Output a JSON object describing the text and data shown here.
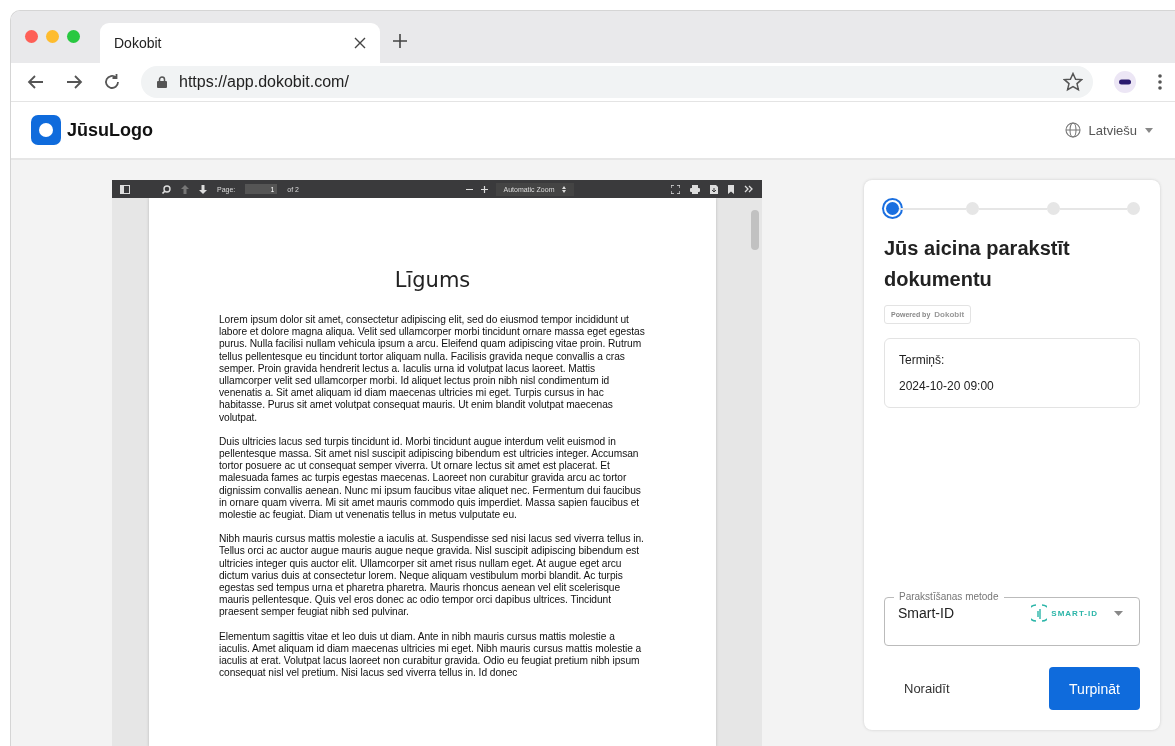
{
  "browser": {
    "tab": {
      "title": "Dokobit"
    },
    "url": "https://app.dokobit.com/"
  },
  "header": {
    "logo": "JūsuLogo",
    "language": "Latviešu"
  },
  "pdf_viewer": {
    "toolbar": {
      "page_label": "Page:",
      "page": "1",
      "page_total": "of 2",
      "zoom": "Automatic Zoom"
    },
    "document": {
      "title": "Līgums",
      "paragraphs": [
        "Lorem ipsum dolor sit amet, consectetur adipiscing elit, sed do eiusmod tempor incididunt ut labore et dolore magna aliqua. Velit sed ullamcorper morbi tincidunt ornare massa eget egestas purus. Nulla facilisi nullam vehicula ipsum a arcu. Eleifend quam adipiscing vitae proin. Rutrum tellus pellentesque eu tincidunt tortor aliquam nulla. Facilisis gravida neque convallis a cras semper. Proin gravida hendrerit lectus a. Iaculis urna id volutpat lacus laoreet. Mattis ullamcorper velit sed ullamcorper morbi. Id aliquet lectus proin nibh nisl condimentum id venenatis a. Sit amet aliquam id diam maecenas ultricies mi eget. Turpis cursus in hac habitasse. Purus sit amet volutpat consequat mauris. Ut enim blandit volutpat maecenas volutpat.",
        "Duis ultricies lacus sed turpis tincidunt id. Morbi tincidunt augue interdum velit euismod in pellentesque massa. Sit amet nisl suscipit adipiscing bibendum est ultricies integer. Accumsan tortor posuere ac ut consequat semper viverra. Ut ornare lectus sit amet est placerat. Et malesuada fames ac turpis egestas maecenas. Laoreet non curabitur gravida arcu ac tortor dignissim convallis aenean. Nunc mi ipsum faucibus vitae aliquet nec. Fermentum dui faucibus in ornare quam viverra. Mi sit amet mauris commodo quis imperdiet. Massa sapien faucibus et molestie ac feugiat. Diam ut venenatis tellus in metus vulputate eu.",
        "Nibh mauris cursus mattis molestie a iaculis at. Suspendisse sed nisi lacus sed viverra tellus in. Tellus orci ac auctor augue mauris augue neque gravida. Nisl suscipit adipiscing bibendum est ultricies integer quis auctor elit. Ullamcorper sit amet risus nullam eget. At augue eget arcu dictum varius duis at consectetur lorem. Neque aliquam vestibulum morbi blandit. Ac turpis egestas sed tempus urna et pharetra pharetra. Mauris rhoncus aenean vel elit scelerisque mauris pellentesque. Quis vel eros donec ac odio tempor orci dapibus ultrices. Tincidunt praesent semper feugiat nibh sed pulvinar.",
        "Elementum sagittis vitae et leo duis ut diam. Ante in nibh mauris cursus mattis molestie a iaculis. Amet aliquam id diam maecenas ultricies mi eget. Nibh mauris cursus mattis molestie a iaculis at erat. Volutpat lacus laoreet non curabitur gravida. Odio eu feugiat pretium nibh ipsum consequat nisl vel pretium. Nisi lacus sed viverra tellus in. Id donec"
      ]
    }
  },
  "signing_panel": {
    "steps": [
      {
        "selected": true
      },
      {
        "selected": false
      },
      {
        "selected": false
      },
      {
        "selected": false
      }
    ],
    "title": "Jūs aicina parakstīt dokumentu",
    "powered_by": "Powered by",
    "powered_brand": "Dokobit",
    "deadline": {
      "label": "Termiņš:",
      "value": "2024-10-20 09:00"
    },
    "method": {
      "label": "Parakstīšanas metode",
      "value": "Smart-ID",
      "logo_text": "SMART-ID"
    },
    "buttons": {
      "reject": "Noraidīt",
      "continue": "Turpināt"
    }
  }
}
